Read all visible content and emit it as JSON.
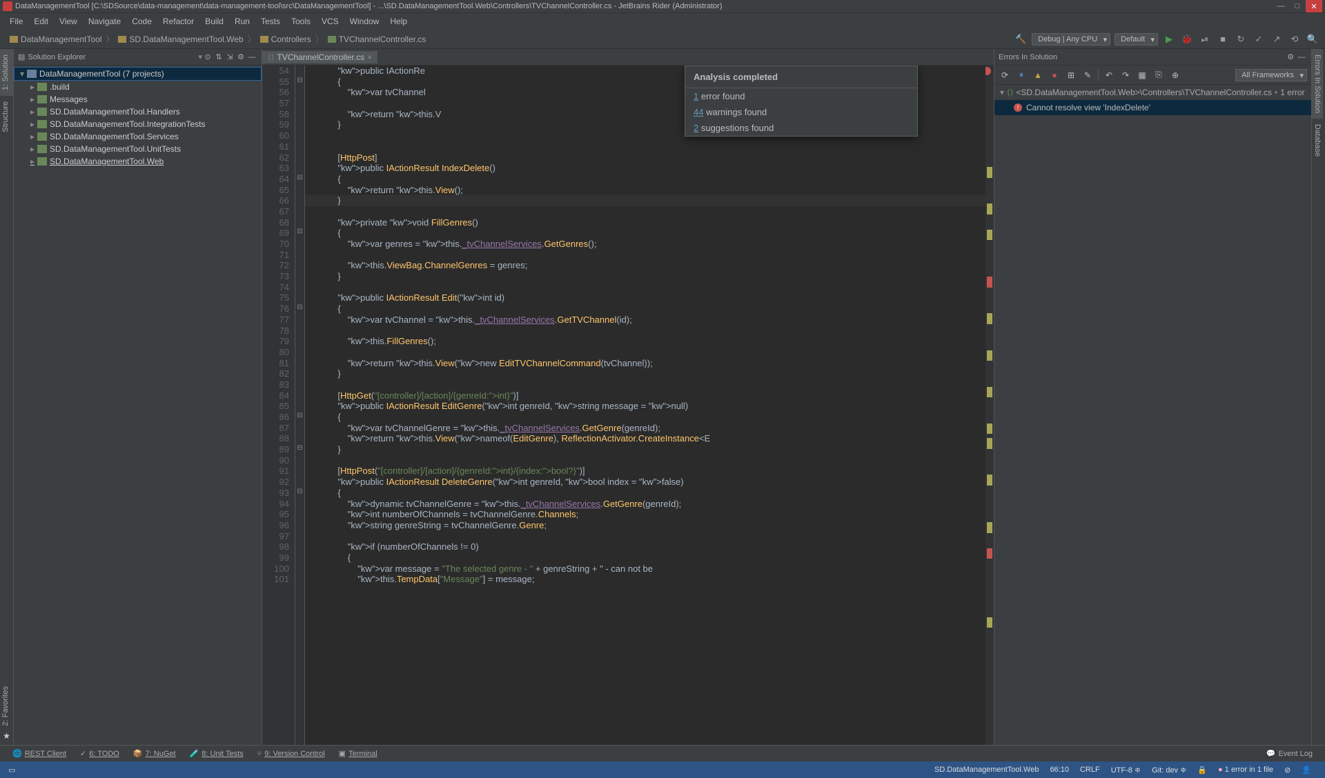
{
  "title": "DataManagementTool [C:\\SDSource\\data-management\\data-management-tool\\src\\DataManagementTool] - ...\\SD.DataManagementTool.Web\\Controllers\\TVChannelController.cs - JetBrains Rider (Administrator)",
  "menu": [
    "File",
    "Edit",
    "View",
    "Navigate",
    "Code",
    "Refactor",
    "Build",
    "Run",
    "Tests",
    "Tools",
    "VCS",
    "Window",
    "Help"
  ],
  "breadcrumbs": [
    "DataManagementTool",
    "SD.DataManagementTool.Web",
    "Controllers",
    "TVChannelController.cs"
  ],
  "run_config": "Debug | Any CPU",
  "run_target": "Default",
  "explorer": {
    "title": "Solution Explorer",
    "root": "DataManagementTool (7 projects)",
    "items": [
      ".build",
      "Messages",
      "SD.DataManagementTool.Handlers",
      "SD.DataManagementTool.IntegrationTests",
      "SD.DataManagementTool.Services",
      "SD.DataManagementTool.UnitTests",
      "SD.DataManagementTool.Web"
    ]
  },
  "tab": "TVChannelController.cs",
  "line_start": 54,
  "line_end": 101,
  "tooltip": {
    "title": "Analysis completed",
    "errors": "1",
    "errors_suffix": " error found",
    "warnings": "44",
    "warnings_suffix": " warnings found",
    "suggestions": "2",
    "suggestions_suffix": " suggestions found"
  },
  "errors_panel": {
    "title": "Errors In Solution",
    "framework": "All Frameworks",
    "path": "<SD.DataManagementTool.Web>\\Controllers\\TVChannelController.cs",
    "count": "1 error",
    "item": "Cannot resolve view 'IndexDelete'"
  },
  "left_rails": [
    "1: Solution",
    "Structure"
  ],
  "right_rails": [
    "Errors In Solution",
    "Database"
  ],
  "footer": [
    "REST Client",
    "6: TODO",
    "7: NuGet",
    "8: Unit Tests",
    "9: Version Control",
    "Terminal"
  ],
  "footer_right": "Event Log",
  "status": {
    "left": "SD.DataManagementTool.Web",
    "pos": "66:10",
    "eol": "CRLF",
    "enc": "UTF-8",
    "git": "Git: dev",
    "err": "1 error in 1 file"
  },
  "code": [
    "            public IActionRe",
    "            {",
    "                var tvChannel",
    "",
    "                return this.V",
    "            }",
    "",
    "",
    "            [HttpPost]",
    "            public IActionResult IndexDelete()",
    "            {",
    "                return this.View();",
    "            }",
    "",
    "            private void FillGenres()",
    "            {",
    "                var genres = this._tvChannelServices.GetGenres();",
    "",
    "                this.ViewBag.ChannelGenres = genres;",
    "            }",
    "",
    "            public IActionResult Edit(int id)",
    "            {",
    "                var tvChannel = this._tvChannelServices.GetTVChannel(id);",
    "",
    "                this.FillGenres();",
    "",
    "                return this.View(new EditTVChannelCommand(tvChannel));",
    "            }",
    "",
    "            [HttpGet(\"[controller]/[action]/{genreId:int}\")]",
    "            public IActionResult EditGenre(int genreId, string message = null)",
    "            {",
    "                var tvChannelGenre = this._tvChannelServices.GetGenre(genreId);",
    "                return this.View(nameof(EditGenre), ReflectionActivator.CreateInstance<E",
    "            }",
    "",
    "            [HttpPost(\"[controller]/[action]/{genreId:int}/{index:bool?}\")]",
    "            public IActionResult DeleteGenre(int genreId, bool index = false)",
    "            {",
    "                dynamic tvChannelGenre = this._tvChannelServices.GetGenre(genreId);",
    "                int numberOfChannels = tvChannelGenre.Channels;",
    "                string genreString = tvChannelGenre.Genre;",
    "",
    "                if (numberOfChannels != 0)",
    "                {",
    "                    var message = \"The selected genre - \" + genreString + \" - can not be",
    "                    this.TempData[\"Message\"] = message;"
  ]
}
